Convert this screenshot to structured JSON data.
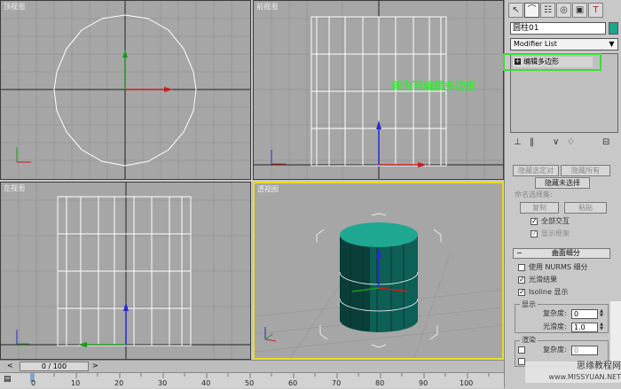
{
  "viewports": {
    "top": "顶视图",
    "front": "前视图",
    "left": "左视图",
    "perspective": "透视图"
  },
  "annotation": "转为可编辑多边形",
  "panel": {
    "tabs": [
      "create-tab",
      "modify-tab",
      "hierarchy-tab",
      "motion-tab",
      "display-tab",
      "utilities-tab"
    ],
    "object_name": "圆柱01",
    "object_color": "#1aa78e",
    "modifier_list": "Modifier List",
    "stack_item": "编辑多边形",
    "selection": {
      "btn_partial_left": "隐藏选定对",
      "btn_partial_right": "隐藏所有",
      "hide_unselected": "隐藏未选择",
      "named_sel_label": "命名选择集:",
      "copy": "复制",
      "paste": "粘贴",
      "full_interact": "全部交互",
      "show_cage": "显示框架"
    },
    "subdivision": {
      "header": "曲面细分",
      "use_nurms": "使用 NURMS 细分",
      "smooth_result": "光滑结果",
      "isoline": "Isoline 显示",
      "display_group": "显示",
      "iterations_label": "复杂度:",
      "iterations_value": "0",
      "smoothness_label": "光滑度:",
      "smoothness_value": "1.0",
      "render_group": "渲染",
      "render_iter_label": "复杂度:",
      "render_iter_value": "0"
    }
  },
  "timeline": {
    "slider_label": "0 / 100",
    "ticks": [
      "0",
      "10",
      "20",
      "30",
      "40",
      "50",
      "60",
      "70",
      "80",
      "90",
      "100"
    ]
  },
  "watermark": {
    "line1": "思缘教程网",
    "line2": "www.MISSYUAN.NET"
  }
}
